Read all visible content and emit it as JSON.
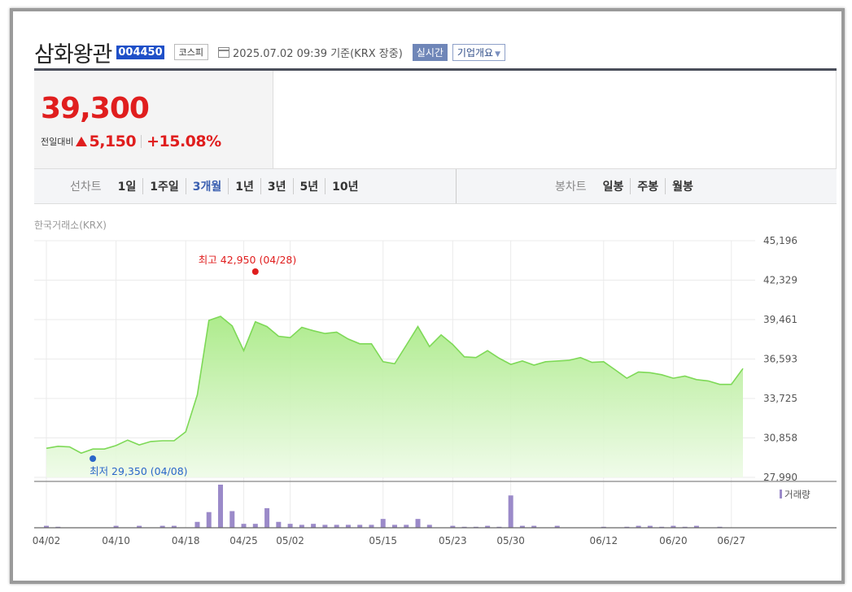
{
  "header": {
    "company": "삼화왕관",
    "code": "004450",
    "market": "코스피",
    "as_of": "2025.07.02 09:39 기준(KRX 장중)",
    "realtime": "실시간",
    "company_profile": "기업개요"
  },
  "price": {
    "current": "39,300",
    "change_label": "전일대비",
    "change": "5,150",
    "change_pct": "+15.08%"
  },
  "periods": {
    "line_label": "선차트",
    "line_items": [
      "1일",
      "1주일",
      "3개월",
      "1년",
      "3년",
      "5년",
      "10년"
    ],
    "active": "3개월",
    "candle_label": "봉차트",
    "candle_items": [
      "일봉",
      "주봉",
      "월봉"
    ]
  },
  "source": "한국거래소(KRX)",
  "colors": {
    "up": "#e01e1e",
    "line": "#7ed957",
    "volume": "#9b8ac9",
    "low": "#2a66c9",
    "active_period": "#3a5fb0"
  },
  "chart_data": {
    "type": "area",
    "ylim": [
      27990,
      45196
    ],
    "yticks": [
      "45,196",
      "42,329",
      "39,461",
      "36,593",
      "33,725",
      "30,858",
      "27,990"
    ],
    "ytick_values": [
      45196,
      42329,
      39461,
      36593,
      33725,
      30858,
      27990
    ],
    "x_labels": [
      "04/02",
      "04/10",
      "04/18",
      "04/25",
      "05/02",
      "05/15",
      "05/23",
      "05/30",
      "06/12",
      "06/20",
      "06/27"
    ],
    "x_label_index": [
      0,
      6,
      12,
      17,
      21,
      29,
      35,
      40,
      48,
      54,
      59
    ],
    "values": [
      30100,
      30250,
      30200,
      29750,
      30050,
      30050,
      30300,
      30700,
      30350,
      30600,
      30650,
      30650,
      31300,
      34000,
      39400,
      39700,
      39000,
      37200,
      39300,
      38950,
      38250,
      38150,
      38900,
      38650,
      38450,
      38550,
      38050,
      37700,
      37700,
      36400,
      36250,
      37600,
      38950,
      37500,
      38350,
      37650,
      36750,
      36700,
      37200,
      36650,
      36200,
      36450,
      36150,
      36400,
      36450,
      36500,
      36700,
      36350,
      36400,
      35800,
      35200,
      35650,
      35600,
      35450,
      35200,
      35350,
      35100,
      35000,
      34750,
      34750,
      35900
    ],
    "high": {
      "label": "최고",
      "value": "42,950",
      "date": "(04/28)",
      "price": 42950,
      "index": 18
    },
    "low": {
      "label": "최저",
      "value": "29,350",
      "date": "(04/08)",
      "price": 29350,
      "index": 4
    },
    "volume_label": "거래량",
    "volume": [
      2,
      1,
      0,
      0,
      0,
      0,
      2,
      0,
      2,
      0,
      2,
      2,
      0,
      6,
      16,
      44,
      17,
      4,
      4,
      20,
      6,
      4,
      3,
      4,
      3,
      3,
      3,
      3,
      3,
      9,
      3,
      3,
      9,
      3,
      0,
      2,
      1,
      1,
      2,
      1,
      33,
      2,
      2,
      0,
      2,
      0,
      0,
      0,
      1,
      0,
      1,
      2,
      2,
      1,
      2,
      1,
      2,
      0,
      1,
      0,
      0
    ]
  }
}
